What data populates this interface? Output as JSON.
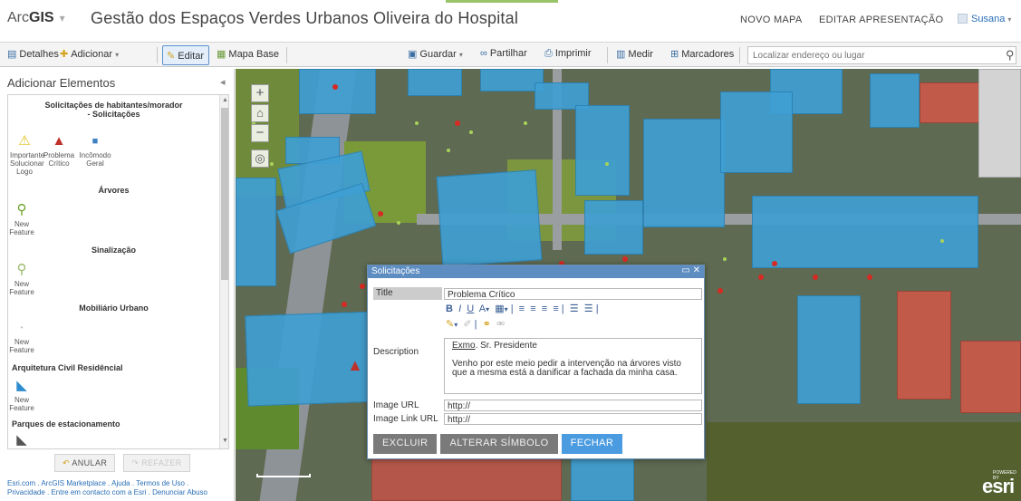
{
  "header": {
    "brand_light": "Arc",
    "brand_bold": "GIS",
    "brand_arrow": "▾",
    "map_title": "Gestão dos Espaços Verdes Urbanos Oliveira do Hospital",
    "new_map": "NOVO MAPA",
    "edit_presentation": "EDITAR APRESENTAÇÃO",
    "user": "Susana",
    "user_arrow": "▾"
  },
  "toolbar": {
    "details": "Detalhes",
    "add": "Adicionar",
    "edit": "Editar",
    "basemap": "Mapa Base",
    "save": "Guardar",
    "share": "Partilhar",
    "print": "Imprimir",
    "measure": "Medir",
    "bookmarks": "Marcadores",
    "search_placeholder": "Localizar endereço ou lugar"
  },
  "sidebar": {
    "heading": "Adicionar Elementos",
    "groups": [
      {
        "title": "Solicitações de habitantes/morador - Solicitações"
      },
      {
        "title": "Árvores"
      },
      {
        "title": "Sinalização"
      },
      {
        "title": "Mobiliário Urbano"
      },
      {
        "title": "Arquitetura Civil Residêncial"
      },
      {
        "title": "Parques de estacionamento"
      }
    ],
    "items": [
      {
        "label": "Importante Solucionar Logo",
        "icon": "warning-triangle-icon"
      },
      {
        "label": "Problema Crítico",
        "icon": "alert-triangle-icon"
      },
      {
        "label": "Incômodo Geral",
        "icon": "blue-square-icon"
      },
      {
        "label": "New Feature",
        "icon": "tree-icon"
      },
      {
        "label": "New Feature",
        "icon": "sign-icon"
      },
      {
        "label": "New Feature",
        "icon": "dot-icon"
      },
      {
        "label": "New Feature",
        "icon": "blue-polygon-icon"
      }
    ],
    "undo": "ANULAR",
    "redo": "REFAZER",
    "footer": "Esri.com . ArcGIS Marketplace . Ajuda . Termos de Uso . Privacidade . Entre em contacto com a Esri . Denunciar Abuso"
  },
  "popup": {
    "window_title": "Solicitações",
    "title_label": "Title",
    "title_value": "Problema Crítico",
    "description_label": "Description",
    "description_salutation": "Exmo",
    "description_salutation_rest": ". Sr. Presidente",
    "description_body": "Venho por este meio pedir a intervenção na árvores visto que a mesma está a danificar a fachada da minha casa.",
    "image_url_label": "Image URL",
    "image_url_value": "http://",
    "image_link_label": "Image Link URL",
    "image_link_value": "http://",
    "btn_delete": "EXCLUIR",
    "btn_symbol": "ALTERAR SÍMBOLO",
    "btn_close": "FECHAR"
  },
  "map": {
    "attribution": "esri",
    "powered_by": "POWERED BY"
  },
  "colors": {
    "accent": "#4a9be0",
    "building": "#3f9fd3",
    "popup_title": "#5e8dc2"
  }
}
